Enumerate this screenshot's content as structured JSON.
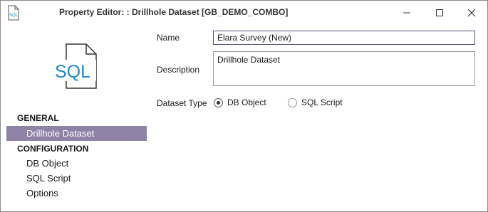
{
  "window": {
    "title": "Property Editor: : Drillhole Dataset [GB_DEMO_COMBO]",
    "app_icon_text": "SQL"
  },
  "sidebar": {
    "icon_text": "SQL",
    "sections": [
      {
        "header": "GENERAL",
        "items": [
          {
            "label": "Drillhole Dataset",
            "selected": true
          }
        ]
      },
      {
        "header": "CONFIGURATION",
        "items": [
          {
            "label": "DB Object",
            "selected": false
          },
          {
            "label": "SQL Script",
            "selected": false
          },
          {
            "label": "Options",
            "selected": false
          }
        ]
      }
    ]
  },
  "form": {
    "name_label": "Name",
    "name_value": "Elara Survey (New)",
    "description_label": "Description",
    "description_value": "Drillhole Dataset",
    "dataset_type_label": "Dataset Type",
    "dataset_type_options": [
      {
        "label": "DB Object",
        "checked": true
      },
      {
        "label": "SQL Script",
        "checked": false
      }
    ]
  },
  "colors": {
    "selected_bg": "#8e83a6",
    "icon_blue": "#1e88c8",
    "focus_border": "#5b4f7a"
  }
}
